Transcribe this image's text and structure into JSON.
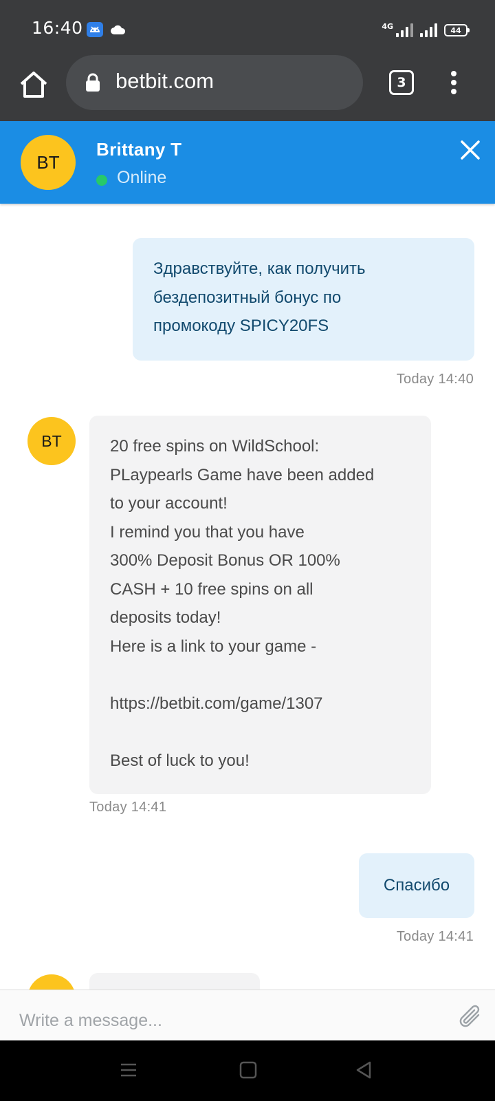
{
  "status_bar": {
    "time": "16:40",
    "network": "4G",
    "battery": "44"
  },
  "browser": {
    "url": "betbit.com",
    "tab_count": "3"
  },
  "chat_header": {
    "avatar_initials": "BT",
    "agent_name": "Brittany T",
    "status": "Online",
    "status_color": "#27c96a",
    "header_color": "#1b8de4"
  },
  "messages": [
    {
      "sender": "user",
      "text": "Здравствуйте, как получить\nбездепозитный бонус по\nпромокоду SPICY20FS",
      "time": "Today 14:40"
    },
    {
      "sender": "agent",
      "avatar": "BT",
      "text": "20 free spins on WildSchool:\nPLaypearls Game have been added\nto your account!\nI remind you that you have\n300% Deposit Bonus OR 100%\nCASH + 10 free spins on all\ndeposits today!\nHere is a link to your game -\n\nhttps://betbit.com/game/1307\n\nBest of luck to you!",
      "time": "Today 14:41"
    },
    {
      "sender": "user",
      "text": "Спасибо",
      "time": "Today 14:41"
    },
    {
      "sender": "agent",
      "avatar": "BT",
      "text": "",
      "time": ""
    }
  ],
  "composer": {
    "placeholder": "Write a message..."
  }
}
